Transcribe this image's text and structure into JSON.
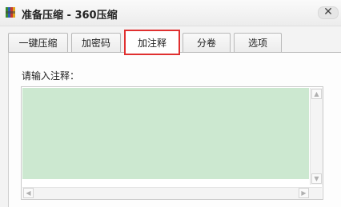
{
  "window": {
    "title": "准备压缩 - 360压缩",
    "close_glyph": "✕",
    "icon": "archive-app-icon"
  },
  "tabs": [
    {
      "label": "一键压缩",
      "active": false
    },
    {
      "label": "加密码",
      "active": false
    },
    {
      "label": "加注释",
      "active": true
    },
    {
      "label": "分卷",
      "active": false
    },
    {
      "label": "选项",
      "active": false
    }
  ],
  "comment": {
    "label": "请输入注释：",
    "value": "",
    "background": "#cce8d0"
  },
  "scrollbars": {
    "up": "▲",
    "down": "▼",
    "left": "◀",
    "right": "▶"
  },
  "colors": {
    "active_tab_border": "#e03030"
  }
}
